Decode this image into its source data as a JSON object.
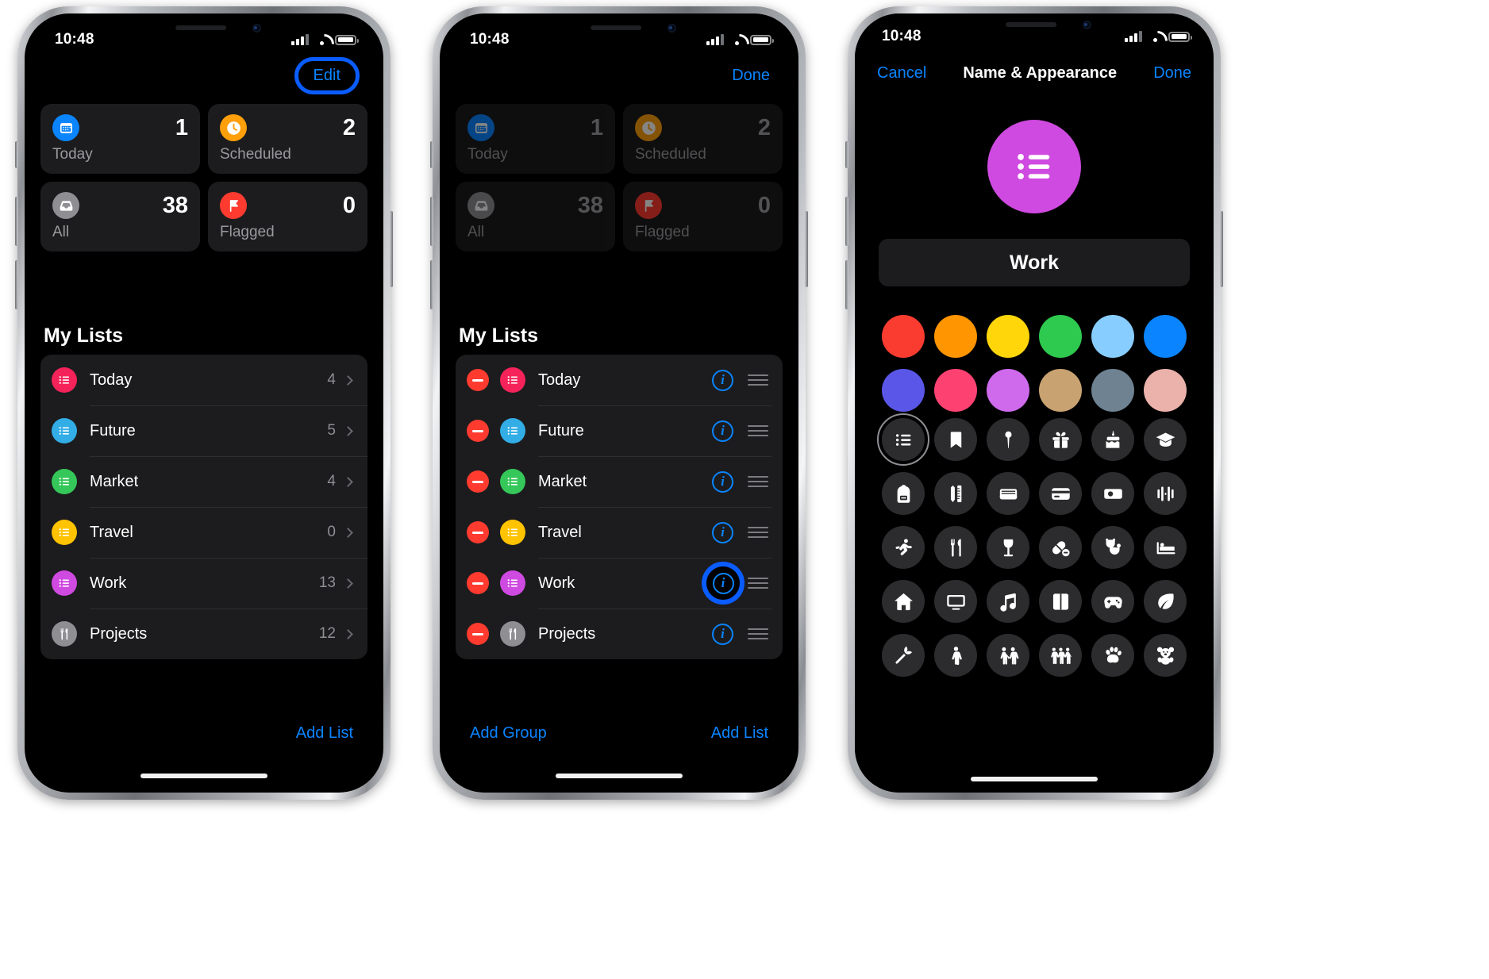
{
  "status_bar": {
    "time": "10:48",
    "signal_icon": "cellular-bars-icon",
    "wifi_icon": "wifi-icon",
    "battery_icon": "battery-icon"
  },
  "phone1": {
    "nav": {
      "edit_label": "Edit"
    },
    "smart_cards": [
      {
        "label": "Today",
        "count": "1",
        "icon": "calendar-icon",
        "color": "#0a84ff"
      },
      {
        "label": "Scheduled",
        "count": "2",
        "icon": "clock-icon",
        "color": "#ff9f0a"
      },
      {
        "label": "All",
        "count": "38",
        "icon": "inbox-icon",
        "color": "#8e8e93"
      },
      {
        "label": "Flagged",
        "count": "0",
        "icon": "flag-icon",
        "color": "#ff3b30"
      }
    ],
    "section_title": "My Lists",
    "lists": [
      {
        "name": "Today",
        "count": "4",
        "color": "#f5235a",
        "icon": "list-bullet-icon"
      },
      {
        "name": "Future",
        "count": "5",
        "color": "#32ade6",
        "icon": "list-bullet-icon"
      },
      {
        "name": "Market",
        "count": "4",
        "color": "#35c759",
        "icon": "list-bullet-icon"
      },
      {
        "name": "Travel",
        "count": "0",
        "color": "#ffc300",
        "icon": "list-bullet-icon"
      },
      {
        "name": "Work",
        "count": "13",
        "color": "#cf4ae0",
        "icon": "list-bullet-icon"
      },
      {
        "name": "Projects",
        "count": "12",
        "color": "#8e8e93",
        "icon": "tools-icon"
      }
    ],
    "bottom": {
      "add_list_label": "Add List"
    }
  },
  "phone2": {
    "nav": {
      "done_label": "Done"
    },
    "smart_cards": [
      {
        "label": "Today",
        "count": "1",
        "icon": "calendar-icon",
        "color": "#0a84ff"
      },
      {
        "label": "Scheduled",
        "count": "2",
        "icon": "clock-icon",
        "color": "#ff9f0a"
      },
      {
        "label": "All",
        "count": "38",
        "icon": "inbox-icon",
        "color": "#8e8e93"
      },
      {
        "label": "Flagged",
        "count": "0",
        "icon": "flag-icon",
        "color": "#ff3b30"
      }
    ],
    "section_title": "My Lists",
    "lists": [
      {
        "name": "Today",
        "color": "#f5235a",
        "icon": "list-bullet-icon",
        "highlighted": false
      },
      {
        "name": "Future",
        "color": "#32ade6",
        "icon": "list-bullet-icon",
        "highlighted": false
      },
      {
        "name": "Market",
        "color": "#35c759",
        "icon": "list-bullet-icon",
        "highlighted": false
      },
      {
        "name": "Travel",
        "color": "#ffc300",
        "icon": "list-bullet-icon",
        "highlighted": false
      },
      {
        "name": "Work",
        "color": "#cf4ae0",
        "icon": "list-bullet-icon",
        "highlighted": true
      },
      {
        "name": "Projects",
        "color": "#8e8e93",
        "icon": "tools-icon",
        "highlighted": false
      }
    ],
    "bottom": {
      "add_group_label": "Add Group",
      "add_list_label": "Add List"
    }
  },
  "phone3": {
    "nav": {
      "cancel_label": "Cancel",
      "title": "Name & Appearance",
      "done_label": "Done"
    },
    "preview": {
      "color": "#cf4ae0",
      "icon": "list-bullet-icon"
    },
    "name_value": "Work",
    "colors": [
      {
        "name": "red",
        "hex": "#fa3c30"
      },
      {
        "name": "orange",
        "hex": "#ff9500"
      },
      {
        "name": "yellow",
        "hex": "#ffd60a"
      },
      {
        "name": "green",
        "hex": "#2ec94f"
      },
      {
        "name": "light-blue",
        "hex": "#88cdff"
      },
      {
        "name": "blue",
        "hex": "#0a84ff"
      },
      {
        "name": "indigo",
        "hex": "#5a57e8"
      },
      {
        "name": "pink",
        "hex": "#fd4272"
      },
      {
        "name": "violet",
        "hex": "#cf6aed"
      },
      {
        "name": "tan",
        "hex": "#c9a272"
      },
      {
        "name": "slate-gray",
        "hex": "#6e8291"
      },
      {
        "name": "light-pink",
        "hex": "#eab2ab"
      }
    ],
    "selected_color": "#cf4ae0",
    "icons": [
      "list-bullet-icon",
      "bookmark-icon",
      "pin-icon",
      "gift-icon",
      "cake-icon",
      "graduation-cap-icon",
      "backpack-icon",
      "pencil-ruler-icon",
      "wallet-icon",
      "credit-card-icon",
      "money-icon",
      "chart-bars-icon",
      "running-icon",
      "fork-knife-icon",
      "wine-glass-icon",
      "pills-icon",
      "stethoscope-icon",
      "bed-icon",
      "house-icon",
      "tv-icon",
      "music-note-icon",
      "book-icon",
      "gamepad-icon",
      "leaf-icon",
      "carrot-icon",
      "person-icon",
      "two-people-icon",
      "three-people-icon",
      "paw-icon",
      "teddy-bear-icon"
    ],
    "selected_icon_index": 0
  }
}
